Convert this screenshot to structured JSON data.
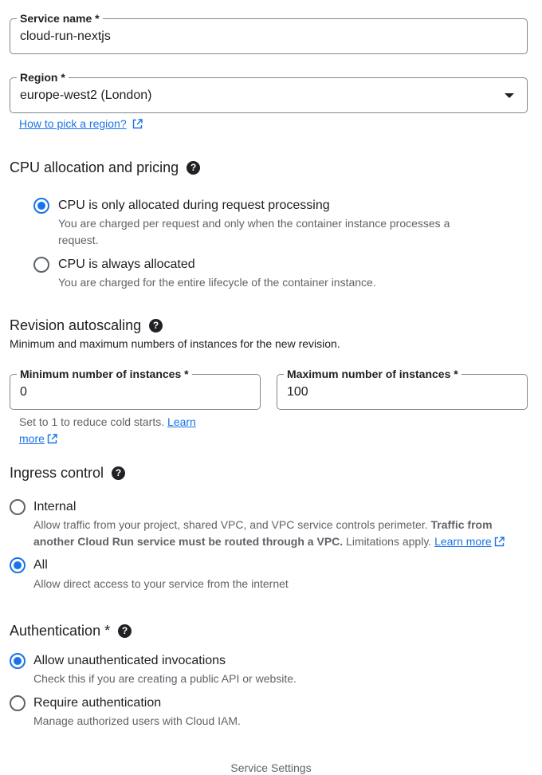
{
  "service_name": {
    "label": "Service name *",
    "value": "cloud-run-nextjs"
  },
  "region": {
    "label": "Region *",
    "value": "europe-west2 (London)",
    "help_link": "How to pick a region?"
  },
  "cpu": {
    "title": "CPU allocation and pricing",
    "options": [
      {
        "label": "CPU is only allocated during request processing",
        "desc_line1": "You are charged per request and only when the container instance processes a",
        "desc_line2": "request.",
        "checked": true
      },
      {
        "label": "CPU is always allocated",
        "desc": "You are charged for the entire lifecycle of the container instance.",
        "checked": false
      }
    ]
  },
  "autoscaling": {
    "title": "Revision autoscaling",
    "subtitle": "Minimum and maximum numbers of instances for the new revision.",
    "min_label": "Minimum number of instances *",
    "min_value": "0",
    "max_label": "Maximum number of instances *",
    "max_value": "100",
    "hint": "Set to 1 to reduce cold starts.",
    "hint_link_1": "Learn",
    "hint_link_2": "more"
  },
  "ingress": {
    "title": "Ingress control",
    "internal_label": "Internal",
    "internal_desc_a": "Allow traffic from your project, shared VPC, and VPC service controls perimeter.",
    "internal_desc_bold_1": "Traffic from",
    "internal_desc_bold_2": "another Cloud Run service must be routed through a VPC.",
    "internal_desc_b": "Limitations apply.",
    "internal_link": "Learn more",
    "all_label": "All",
    "all_desc": "Allow direct access to your service from the internet",
    "selected": "All"
  },
  "auth": {
    "title": "Authentication *",
    "options": [
      {
        "label": "Allow unauthenticated invocations",
        "desc": "Check this if you are creating a public API or website.",
        "checked": true
      },
      {
        "label": "Require authentication",
        "desc": "Manage authorized users with Cloud IAM.",
        "checked": false
      }
    ]
  },
  "caption": "Service Settings",
  "colors": {
    "accent": "#1a73e8",
    "text": "#202124",
    "muted": "#5f6368",
    "border": "#80868b"
  },
  "icons": [
    "dropdown-arrow-icon",
    "external-link-icon",
    "help-icon"
  ]
}
